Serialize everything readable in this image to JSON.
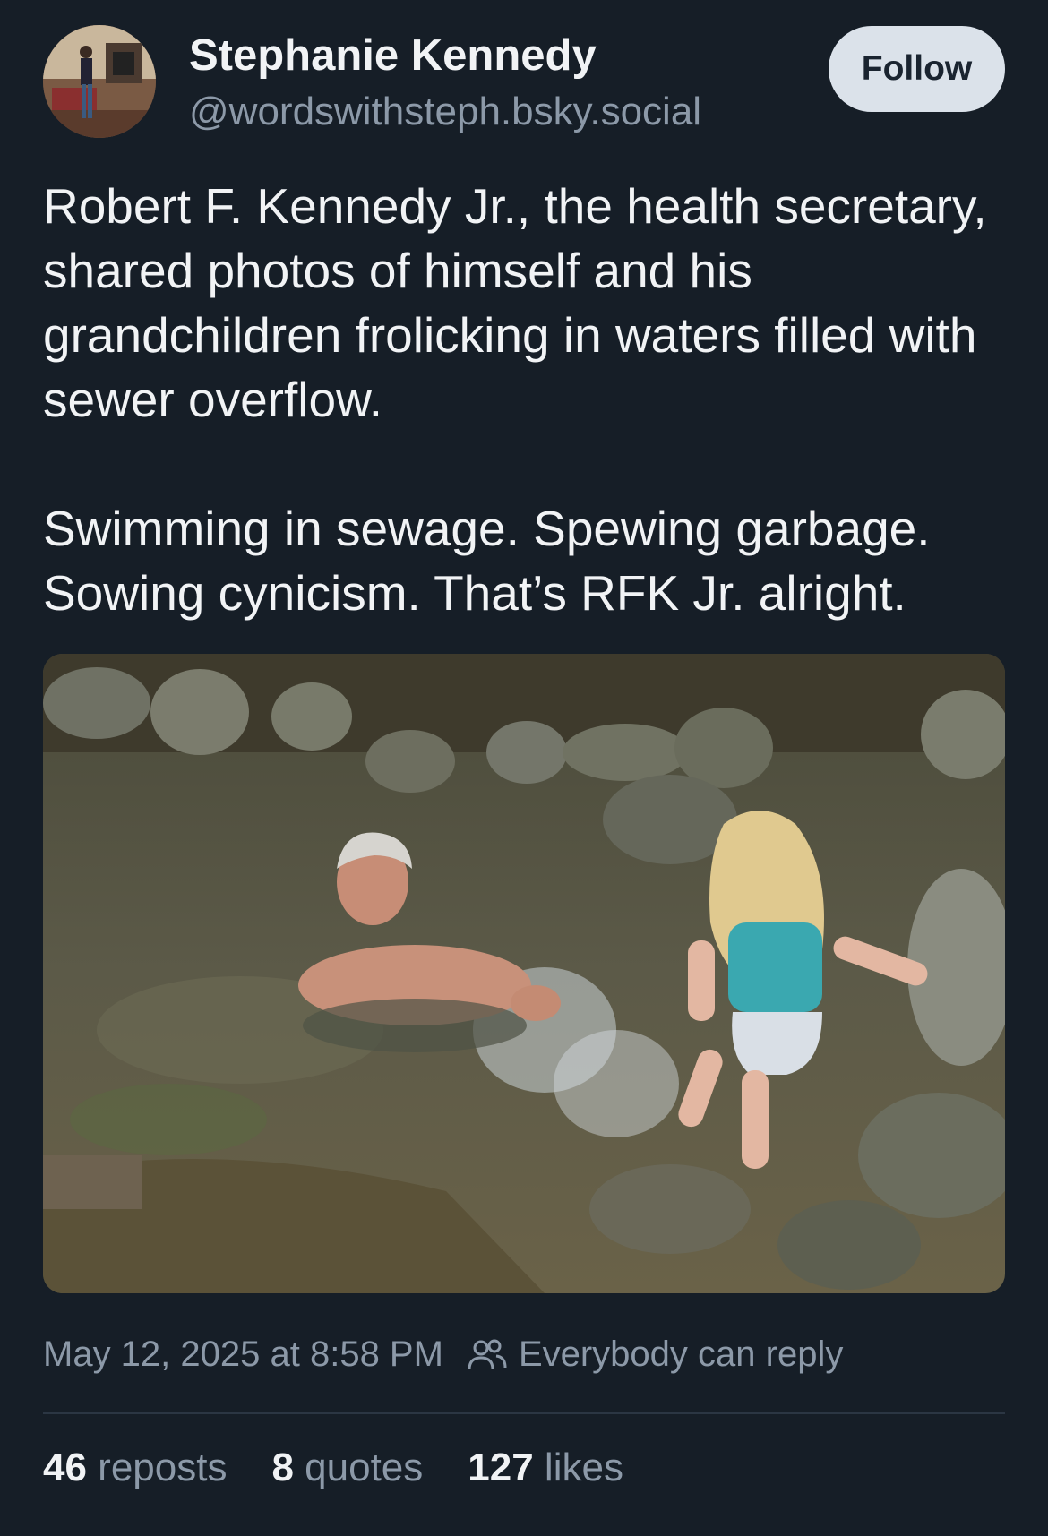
{
  "author": {
    "display_name": "Stephanie Kennedy",
    "handle": "@wordswithsteph.bsky.social",
    "avatar_icon": "profile-photo"
  },
  "follow_label": "Follow",
  "post": {
    "paragraphs": [
      "Robert F. Kennedy Jr., the health secretary, shared photos of himself and his grandchildren frolicking in waters filled with sewer overflow.",
      "Swimming in sewage. Spewing garbage. Sowing cynicism. That’s RFK Jr. alright."
    ],
    "image_description_icon": "photo-creek-swimming"
  },
  "meta": {
    "timestamp": "May 12, 2025 at 8:58 PM",
    "reply_setting": "Everybody can reply",
    "reply_icon": "people-icon"
  },
  "stats": {
    "reposts_count": "46",
    "reposts_label": "reposts",
    "quotes_count": "8",
    "quotes_label": "quotes",
    "likes_count": "127",
    "likes_label": "likes"
  },
  "colors": {
    "background": "#161e27",
    "text": "#f1f3f5",
    "muted": "#8c99a8",
    "follow_button": "#dbe2ea"
  }
}
